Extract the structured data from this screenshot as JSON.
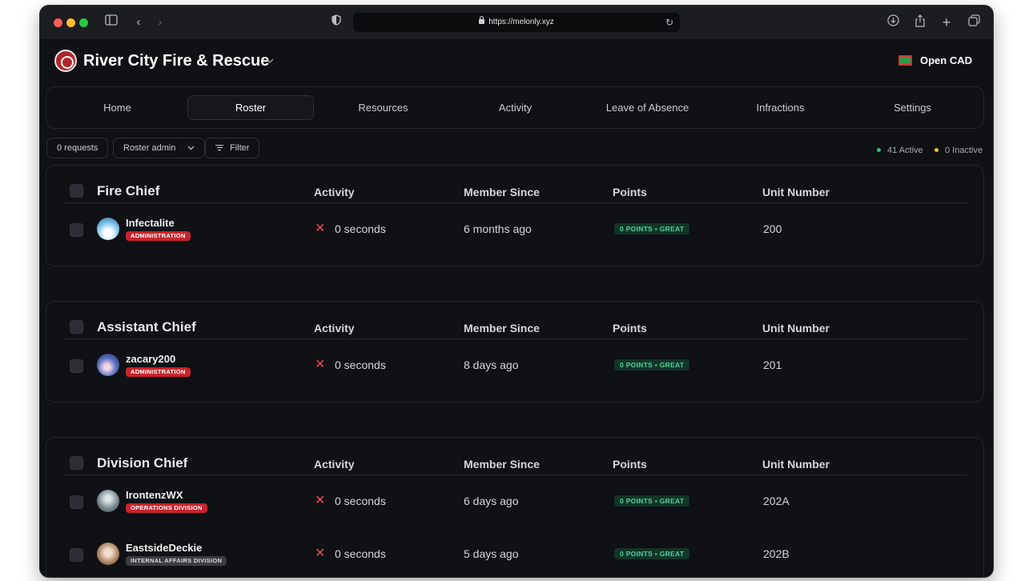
{
  "browser": {
    "url": "https://melonly.xyz"
  },
  "org": {
    "title": "River City Fire & Rescue",
    "open_cad": "Open CAD"
  },
  "tabs": [
    {
      "label": "Home"
    },
    {
      "label": "Roster"
    },
    {
      "label": "Resources"
    },
    {
      "label": "Activity"
    },
    {
      "label": "Leave of Absence"
    },
    {
      "label": "Infractions"
    },
    {
      "label": "Settings"
    }
  ],
  "active_tab": "Roster",
  "toolbar": {
    "requests": "0 requests",
    "roster_admin": "Roster admin",
    "filter": "Filter",
    "active": "41 Active",
    "inactive": "0 Inactive"
  },
  "columns": {
    "activity": "Activity",
    "member_since": "Member Since",
    "points": "Points",
    "unit_number": "Unit Number"
  },
  "colors": {
    "active_dot": "#2fbf71",
    "inactive_dot": "#f2c12e",
    "badge_red": "#c8232d",
    "badge_gray": "#3a3d42"
  },
  "sections": [
    {
      "title": "Fire Chief",
      "members": [
        {
          "name": "Infectalite",
          "badge": "ADMINISTRATION",
          "badge_color": "red",
          "activity": "0 seconds",
          "member_since": "6 months ago",
          "points": "0 POINTS • GREAT",
          "unit": "200"
        }
      ]
    },
    {
      "title": "Assistant Chief",
      "members": [
        {
          "name": "zacary200",
          "badge": "ADMINISTRATION",
          "badge_color": "red",
          "activity": "0 seconds",
          "member_since": "8 days ago",
          "points": "0 POINTS • GREAT",
          "unit": "201"
        }
      ]
    },
    {
      "title": "Division Chief",
      "members": [
        {
          "name": "IrontenzWX",
          "badge": "OPERATIONS DIVISION",
          "badge_color": "red",
          "activity": "0 seconds",
          "member_since": "6 days ago",
          "points": "0 POINTS • GREAT",
          "unit": "202A"
        },
        {
          "name": "EastsideDeckie",
          "badge": "INTERNAL AFFAIRS DIVISION",
          "badge_color": "gray",
          "activity": "0 seconds",
          "member_since": "5 days ago",
          "points": "0 POINTS • GREAT",
          "unit": "202B"
        }
      ]
    }
  ]
}
